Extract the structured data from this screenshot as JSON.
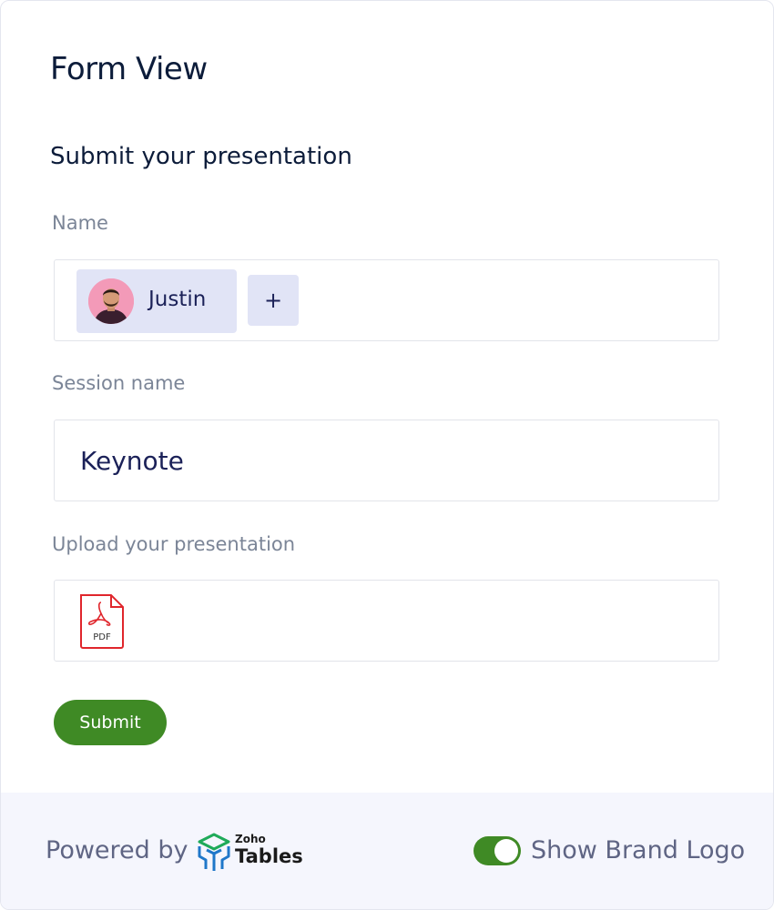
{
  "form": {
    "title": "Form View",
    "subtitle": "Submit your presentation"
  },
  "fields": {
    "name": {
      "label": "Name",
      "user_name": "Justin",
      "add_label": "+"
    },
    "session": {
      "label": "Session name",
      "value": "Keynote"
    },
    "upload": {
      "label": "Upload your presentation",
      "file_badge": "PDF"
    }
  },
  "submit_label": "Submit",
  "footer": {
    "powered_by": "Powered by",
    "logo_small": "Zoho",
    "logo_main": "Tables",
    "toggle_label": "Show Brand Logo",
    "toggle_on": true
  },
  "colors": {
    "accent_green": "#3f8a25",
    "chip_bg": "#e1e4f6",
    "footer_bg": "#f5f6fd",
    "pdf_red": "#e0262c",
    "logo_green": "#1faa59",
    "logo_blue": "#1f77c9"
  }
}
